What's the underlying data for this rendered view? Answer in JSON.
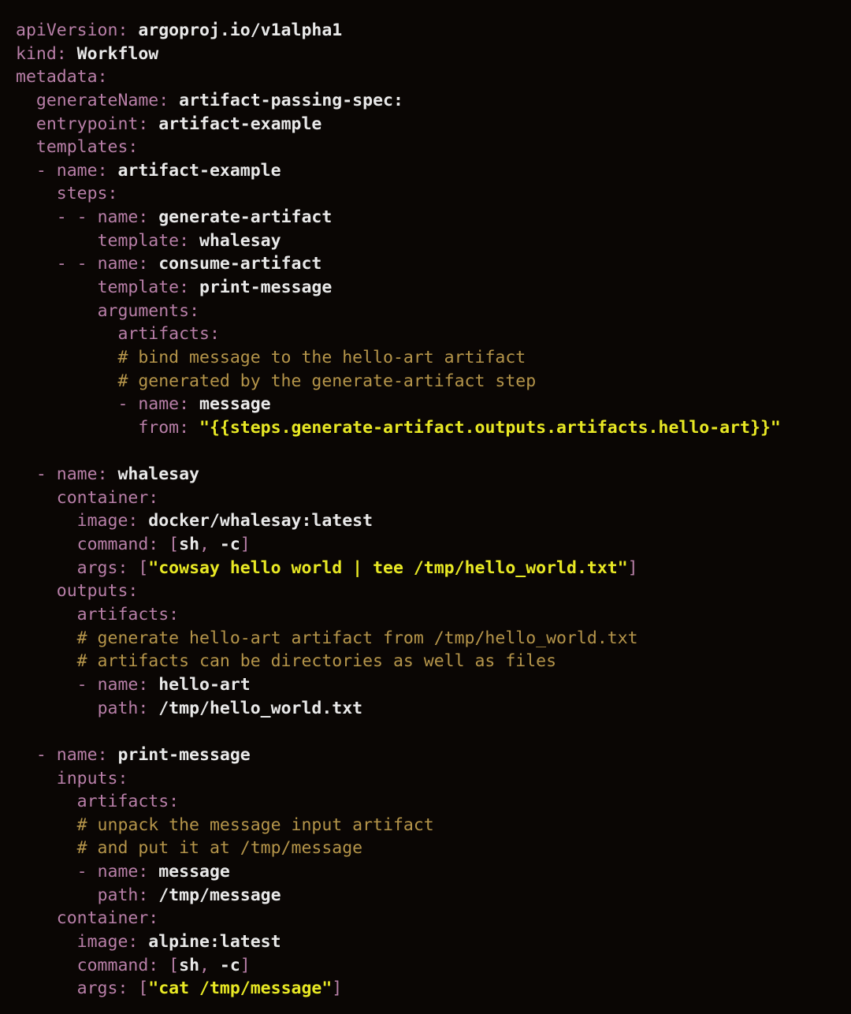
{
  "editor": {
    "language": "yaml",
    "file_kind": "Argo Workflow manifest",
    "background_color": "#0a0604",
    "colors": {
      "key": "#b87fa8",
      "value": "#e9e9e9",
      "comment": "#b5954a",
      "string": "#e8e824",
      "punctuation": "#b87fa8"
    }
  },
  "code": {
    "lines": [
      {
        "indent": 0,
        "tokens": [
          {
            "t": "key",
            "s": "apiVersion"
          },
          {
            "t": "punct",
            "s": ": "
          },
          {
            "t": "val",
            "s": "argoproj.io/v1alpha1"
          }
        ]
      },
      {
        "indent": 0,
        "tokens": [
          {
            "t": "key",
            "s": "kind"
          },
          {
            "t": "punct",
            "s": ": "
          },
          {
            "t": "val",
            "s": "Workflow"
          }
        ]
      },
      {
        "indent": 0,
        "tokens": [
          {
            "t": "key",
            "s": "metadata"
          },
          {
            "t": "punct",
            "s": ":"
          }
        ]
      },
      {
        "indent": 2,
        "tokens": [
          {
            "t": "key",
            "s": "generateName"
          },
          {
            "t": "punct",
            "s": ": "
          },
          {
            "t": "val",
            "s": "artifact-passing-spec:"
          }
        ]
      },
      {
        "indent": 2,
        "tokens": [
          {
            "t": "key",
            "s": "entrypoint"
          },
          {
            "t": "punct",
            "s": ": "
          },
          {
            "t": "val",
            "s": "artifact-example"
          }
        ]
      },
      {
        "indent": 2,
        "tokens": [
          {
            "t": "key",
            "s": "templates"
          },
          {
            "t": "punct",
            "s": ":"
          }
        ]
      },
      {
        "indent": 2,
        "tokens": [
          {
            "t": "punct",
            "s": "- "
          },
          {
            "t": "key",
            "s": "name"
          },
          {
            "t": "punct",
            "s": ": "
          },
          {
            "t": "val",
            "s": "artifact-example"
          }
        ]
      },
      {
        "indent": 4,
        "tokens": [
          {
            "t": "key",
            "s": "steps"
          },
          {
            "t": "punct",
            "s": ":"
          }
        ]
      },
      {
        "indent": 4,
        "tokens": [
          {
            "t": "punct",
            "s": "- - "
          },
          {
            "t": "key",
            "s": "name"
          },
          {
            "t": "punct",
            "s": ": "
          },
          {
            "t": "val",
            "s": "generate-artifact"
          }
        ]
      },
      {
        "indent": 8,
        "tokens": [
          {
            "t": "key",
            "s": "template"
          },
          {
            "t": "punct",
            "s": ": "
          },
          {
            "t": "val",
            "s": "whalesay"
          }
        ]
      },
      {
        "indent": 4,
        "tokens": [
          {
            "t": "punct",
            "s": "- - "
          },
          {
            "t": "key",
            "s": "name"
          },
          {
            "t": "punct",
            "s": ": "
          },
          {
            "t": "val",
            "s": "consume-artifact"
          }
        ]
      },
      {
        "indent": 8,
        "tokens": [
          {
            "t": "key",
            "s": "template"
          },
          {
            "t": "punct",
            "s": ": "
          },
          {
            "t": "val",
            "s": "print-message"
          }
        ]
      },
      {
        "indent": 8,
        "tokens": [
          {
            "t": "key",
            "s": "arguments"
          },
          {
            "t": "punct",
            "s": ":"
          }
        ]
      },
      {
        "indent": 10,
        "tokens": [
          {
            "t": "key",
            "s": "artifacts"
          },
          {
            "t": "punct",
            "s": ":"
          }
        ]
      },
      {
        "indent": 10,
        "tokens": [
          {
            "t": "cmt",
            "s": "# bind message to the hello-art artifact"
          }
        ]
      },
      {
        "indent": 10,
        "tokens": [
          {
            "t": "cmt",
            "s": "# generated by the generate-artifact step"
          }
        ]
      },
      {
        "indent": 10,
        "tokens": [
          {
            "t": "punct",
            "s": "- "
          },
          {
            "t": "key",
            "s": "name"
          },
          {
            "t": "punct",
            "s": ": "
          },
          {
            "t": "val",
            "s": "message"
          }
        ]
      },
      {
        "indent": 12,
        "tokens": [
          {
            "t": "key",
            "s": "from"
          },
          {
            "t": "punct",
            "s": ": "
          },
          {
            "t": "str",
            "s": "\"{{steps.generate-artifact.outputs.artifacts.hello-art}}\""
          }
        ]
      },
      {
        "indent": 0,
        "blank": true,
        "tokens": []
      },
      {
        "indent": 2,
        "tokens": [
          {
            "t": "punct",
            "s": "- "
          },
          {
            "t": "key",
            "s": "name"
          },
          {
            "t": "punct",
            "s": ": "
          },
          {
            "t": "val",
            "s": "whalesay"
          }
        ]
      },
      {
        "indent": 4,
        "tokens": [
          {
            "t": "key",
            "s": "container"
          },
          {
            "t": "punct",
            "s": ":"
          }
        ]
      },
      {
        "indent": 6,
        "tokens": [
          {
            "t": "key",
            "s": "image"
          },
          {
            "t": "punct",
            "s": ": "
          },
          {
            "t": "val",
            "s": "docker/whalesay:latest"
          }
        ]
      },
      {
        "indent": 6,
        "tokens": [
          {
            "t": "key",
            "s": "command"
          },
          {
            "t": "punct",
            "s": ": ["
          },
          {
            "t": "val",
            "s": "sh"
          },
          {
            "t": "punct",
            "s": ", "
          },
          {
            "t": "val",
            "s": "-c"
          },
          {
            "t": "punct",
            "s": "]"
          }
        ]
      },
      {
        "indent": 6,
        "tokens": [
          {
            "t": "key",
            "s": "args"
          },
          {
            "t": "punct",
            "s": ": ["
          },
          {
            "t": "str",
            "s": "\"cowsay hello world | tee /tmp/hello_world.txt\""
          },
          {
            "t": "punct",
            "s": "]"
          }
        ]
      },
      {
        "indent": 4,
        "tokens": [
          {
            "t": "key",
            "s": "outputs"
          },
          {
            "t": "punct",
            "s": ":"
          }
        ]
      },
      {
        "indent": 6,
        "tokens": [
          {
            "t": "key",
            "s": "artifacts"
          },
          {
            "t": "punct",
            "s": ":"
          }
        ]
      },
      {
        "indent": 6,
        "tokens": [
          {
            "t": "cmt",
            "s": "# generate hello-art artifact from /tmp/hello_world.txt"
          }
        ]
      },
      {
        "indent": 6,
        "tokens": [
          {
            "t": "cmt",
            "s": "# artifacts can be directories as well as files"
          }
        ]
      },
      {
        "indent": 6,
        "tokens": [
          {
            "t": "punct",
            "s": "- "
          },
          {
            "t": "key",
            "s": "name"
          },
          {
            "t": "punct",
            "s": ": "
          },
          {
            "t": "val",
            "s": "hello-art"
          }
        ]
      },
      {
        "indent": 8,
        "tokens": [
          {
            "t": "key",
            "s": "path"
          },
          {
            "t": "punct",
            "s": ": "
          },
          {
            "t": "val",
            "s": "/tmp/hello_world.txt"
          }
        ]
      },
      {
        "indent": 0,
        "blank": true,
        "tokens": []
      },
      {
        "indent": 2,
        "tokens": [
          {
            "t": "punct",
            "s": "- "
          },
          {
            "t": "key",
            "s": "name"
          },
          {
            "t": "punct",
            "s": ": "
          },
          {
            "t": "val",
            "s": "print-message"
          }
        ]
      },
      {
        "indent": 4,
        "tokens": [
          {
            "t": "key",
            "s": "inputs"
          },
          {
            "t": "punct",
            "s": ":"
          }
        ]
      },
      {
        "indent": 6,
        "tokens": [
          {
            "t": "key",
            "s": "artifacts"
          },
          {
            "t": "punct",
            "s": ":"
          }
        ]
      },
      {
        "indent": 6,
        "tokens": [
          {
            "t": "cmt",
            "s": "# unpack the message input artifact"
          }
        ]
      },
      {
        "indent": 6,
        "tokens": [
          {
            "t": "cmt",
            "s": "# and put it at /tmp/message"
          }
        ]
      },
      {
        "indent": 6,
        "tokens": [
          {
            "t": "punct",
            "s": "- "
          },
          {
            "t": "key",
            "s": "name"
          },
          {
            "t": "punct",
            "s": ": "
          },
          {
            "t": "val",
            "s": "message"
          }
        ]
      },
      {
        "indent": 8,
        "tokens": [
          {
            "t": "key",
            "s": "path"
          },
          {
            "t": "punct",
            "s": ": "
          },
          {
            "t": "val",
            "s": "/tmp/message"
          }
        ]
      },
      {
        "indent": 4,
        "tokens": [
          {
            "t": "key",
            "s": "container"
          },
          {
            "t": "punct",
            "s": ":"
          }
        ]
      },
      {
        "indent": 6,
        "tokens": [
          {
            "t": "key",
            "s": "image"
          },
          {
            "t": "punct",
            "s": ": "
          },
          {
            "t": "val",
            "s": "alpine:latest"
          }
        ]
      },
      {
        "indent": 6,
        "tokens": [
          {
            "t": "key",
            "s": "command"
          },
          {
            "t": "punct",
            "s": ": ["
          },
          {
            "t": "val",
            "s": "sh"
          },
          {
            "t": "punct",
            "s": ", "
          },
          {
            "t": "val",
            "s": "-c"
          },
          {
            "t": "punct",
            "s": "]"
          }
        ]
      },
      {
        "indent": 6,
        "tokens": [
          {
            "t": "key",
            "s": "args"
          },
          {
            "t": "punct",
            "s": ": ["
          },
          {
            "t": "str",
            "s": "\"cat /tmp/message\""
          },
          {
            "t": "punct",
            "s": "]"
          }
        ]
      }
    ]
  }
}
